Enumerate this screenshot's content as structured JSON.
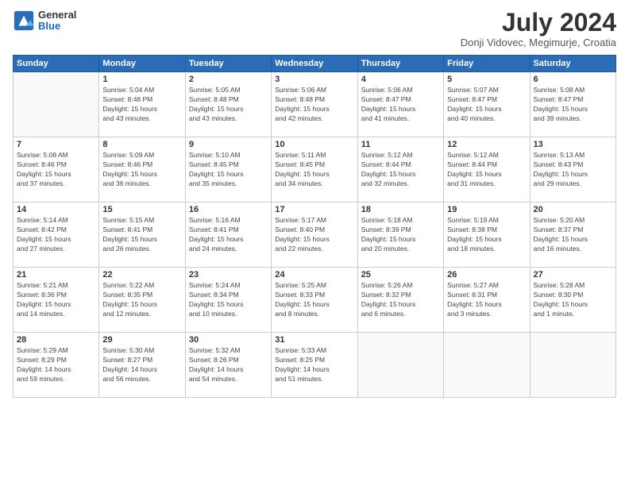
{
  "logo": {
    "general": "General",
    "blue": "Blue"
  },
  "title": "July 2024",
  "location": "Donji Vidovec, Megimurje, Croatia",
  "days_of_week": [
    "Sunday",
    "Monday",
    "Tuesday",
    "Wednesday",
    "Thursday",
    "Friday",
    "Saturday"
  ],
  "weeks": [
    [
      {
        "day": "",
        "info": ""
      },
      {
        "day": "1",
        "info": "Sunrise: 5:04 AM\nSunset: 8:48 PM\nDaylight: 15 hours\nand 43 minutes."
      },
      {
        "day": "2",
        "info": "Sunrise: 5:05 AM\nSunset: 8:48 PM\nDaylight: 15 hours\nand 43 minutes."
      },
      {
        "day": "3",
        "info": "Sunrise: 5:06 AM\nSunset: 8:48 PM\nDaylight: 15 hours\nand 42 minutes."
      },
      {
        "day": "4",
        "info": "Sunrise: 5:06 AM\nSunset: 8:47 PM\nDaylight: 15 hours\nand 41 minutes."
      },
      {
        "day": "5",
        "info": "Sunrise: 5:07 AM\nSunset: 8:47 PM\nDaylight: 15 hours\nand 40 minutes."
      },
      {
        "day": "6",
        "info": "Sunrise: 5:08 AM\nSunset: 8:47 PM\nDaylight: 15 hours\nand 39 minutes."
      }
    ],
    [
      {
        "day": "7",
        "info": "Sunrise: 5:08 AM\nSunset: 8:46 PM\nDaylight: 15 hours\nand 37 minutes."
      },
      {
        "day": "8",
        "info": "Sunrise: 5:09 AM\nSunset: 8:46 PM\nDaylight: 15 hours\nand 36 minutes."
      },
      {
        "day": "9",
        "info": "Sunrise: 5:10 AM\nSunset: 8:45 PM\nDaylight: 15 hours\nand 35 minutes."
      },
      {
        "day": "10",
        "info": "Sunrise: 5:11 AM\nSunset: 8:45 PM\nDaylight: 15 hours\nand 34 minutes."
      },
      {
        "day": "11",
        "info": "Sunrise: 5:12 AM\nSunset: 8:44 PM\nDaylight: 15 hours\nand 32 minutes."
      },
      {
        "day": "12",
        "info": "Sunrise: 5:12 AM\nSunset: 8:44 PM\nDaylight: 15 hours\nand 31 minutes."
      },
      {
        "day": "13",
        "info": "Sunrise: 5:13 AM\nSunset: 8:43 PM\nDaylight: 15 hours\nand 29 minutes."
      }
    ],
    [
      {
        "day": "14",
        "info": "Sunrise: 5:14 AM\nSunset: 8:42 PM\nDaylight: 15 hours\nand 27 minutes."
      },
      {
        "day": "15",
        "info": "Sunrise: 5:15 AM\nSunset: 8:41 PM\nDaylight: 15 hours\nand 26 minutes."
      },
      {
        "day": "16",
        "info": "Sunrise: 5:16 AM\nSunset: 8:41 PM\nDaylight: 15 hours\nand 24 minutes."
      },
      {
        "day": "17",
        "info": "Sunrise: 5:17 AM\nSunset: 8:40 PM\nDaylight: 15 hours\nand 22 minutes."
      },
      {
        "day": "18",
        "info": "Sunrise: 5:18 AM\nSunset: 8:39 PM\nDaylight: 15 hours\nand 20 minutes."
      },
      {
        "day": "19",
        "info": "Sunrise: 5:19 AM\nSunset: 8:38 PM\nDaylight: 15 hours\nand 18 minutes."
      },
      {
        "day": "20",
        "info": "Sunrise: 5:20 AM\nSunset: 8:37 PM\nDaylight: 15 hours\nand 16 minutes."
      }
    ],
    [
      {
        "day": "21",
        "info": "Sunrise: 5:21 AM\nSunset: 8:36 PM\nDaylight: 15 hours\nand 14 minutes."
      },
      {
        "day": "22",
        "info": "Sunrise: 5:22 AM\nSunset: 8:35 PM\nDaylight: 15 hours\nand 12 minutes."
      },
      {
        "day": "23",
        "info": "Sunrise: 5:24 AM\nSunset: 8:34 PM\nDaylight: 15 hours\nand 10 minutes."
      },
      {
        "day": "24",
        "info": "Sunrise: 5:25 AM\nSunset: 8:33 PM\nDaylight: 15 hours\nand 8 minutes."
      },
      {
        "day": "25",
        "info": "Sunrise: 5:26 AM\nSunset: 8:32 PM\nDaylight: 15 hours\nand 6 minutes."
      },
      {
        "day": "26",
        "info": "Sunrise: 5:27 AM\nSunset: 8:31 PM\nDaylight: 15 hours\nand 3 minutes."
      },
      {
        "day": "27",
        "info": "Sunrise: 5:28 AM\nSunset: 8:30 PM\nDaylight: 15 hours\nand 1 minute."
      }
    ],
    [
      {
        "day": "28",
        "info": "Sunrise: 5:29 AM\nSunset: 8:29 PM\nDaylight: 14 hours\nand 59 minutes."
      },
      {
        "day": "29",
        "info": "Sunrise: 5:30 AM\nSunset: 8:27 PM\nDaylight: 14 hours\nand 56 minutes."
      },
      {
        "day": "30",
        "info": "Sunrise: 5:32 AM\nSunset: 8:26 PM\nDaylight: 14 hours\nand 54 minutes."
      },
      {
        "day": "31",
        "info": "Sunrise: 5:33 AM\nSunset: 8:25 PM\nDaylight: 14 hours\nand 51 minutes."
      },
      {
        "day": "",
        "info": ""
      },
      {
        "day": "",
        "info": ""
      },
      {
        "day": "",
        "info": ""
      }
    ]
  ]
}
